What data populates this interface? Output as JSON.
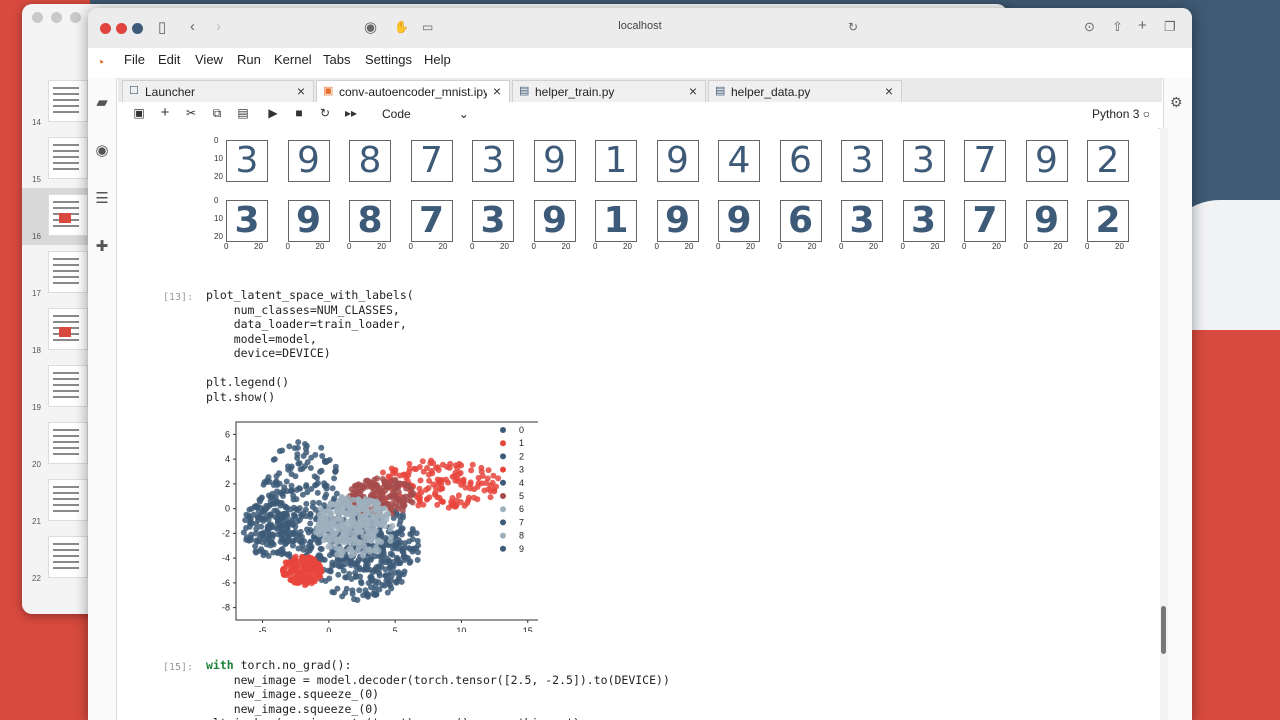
{
  "window": {
    "url": "localhost"
  },
  "menu": [
    "File",
    "Edit",
    "View",
    "Run",
    "Kernel",
    "Tabs",
    "Settings",
    "Help"
  ],
  "tabs": [
    {
      "label": "Launcher",
      "icon": "launcher-icon",
      "active": false
    },
    {
      "label": "conv-autoencoder_mnist.ipy",
      "icon": "notebook-icon",
      "active": true
    },
    {
      "label": "helper_train.py",
      "icon": "python-file-icon",
      "active": false
    },
    {
      "label": "helper_data.py",
      "icon": "python-file-icon",
      "active": false
    }
  ],
  "toolbar": {
    "cell_type": "Code",
    "kernel": "Python 3"
  },
  "slide_numbers": [
    "14",
    "15",
    "16",
    "17",
    "18",
    "19",
    "20",
    "21",
    "22"
  ],
  "digits_original": [
    "3",
    "9",
    "8",
    "7",
    "3",
    "9",
    "1",
    "9",
    "4",
    "6",
    "3",
    "3",
    "7",
    "9",
    "2"
  ],
  "digits_reconstructed": [
    "3",
    "9",
    "8",
    "7",
    "3",
    "9",
    "1",
    "9",
    "9",
    "6",
    "3",
    "3",
    "7",
    "9",
    "2"
  ],
  "digit_axis": {
    "y_ticks": [
      "0",
      "10",
      "20"
    ],
    "x_ticks": [
      "0",
      "20"
    ]
  },
  "cells": [
    {
      "prompt": "[13]:",
      "lines": [
        "plot_latent_space_with_labels(",
        "    num_classes=NUM_CLASSES,",
        "    data_loader=train_loader,",
        "    model=model,",
        "    device=DEVICE)",
        "",
        "plt.legend()",
        "plt.show()"
      ]
    },
    {
      "prompt": "[15]:",
      "lines": [
        "with torch.no_grad():",
        "    new_image = model.decoder(torch.tensor([2.5, -2.5]).to(DEVICE))",
        "    new_image.squeeze_(0)",
        "    new_image.squeeze_(0)",
        "plt.imshow(new_image.to('cpu').numpy(), cmap='binary')"
      ]
    }
  ],
  "chart_data": {
    "type": "scatter",
    "title": "",
    "xlabel": "",
    "ylabel": "",
    "xlim": [
      -7,
      16
    ],
    "ylim": [
      -9,
      7
    ],
    "x_ticks": [
      -5,
      0,
      5,
      10,
      15
    ],
    "y_ticks": [
      6,
      4,
      2,
      0,
      -2,
      -4,
      -6,
      -8
    ],
    "legend": {
      "placement": "right",
      "entries": [
        "0",
        "1",
        "2",
        "3",
        "4",
        "5",
        "6",
        "7",
        "8",
        "9"
      ]
    },
    "series": [
      {
        "name": "0",
        "color": "#3d5a78",
        "cx": 2.5,
        "cy": -4.5,
        "rx": 3.5,
        "ry": 3.0
      },
      {
        "name": "1",
        "color": "#e8453c",
        "cx": 8.0,
        "cy": 2.0,
        "rx": 5.0,
        "ry": 2.0
      },
      {
        "name": "2",
        "color": "#3d5a78",
        "cx": -2.0,
        "cy": 1.0,
        "rx": 3.0,
        "ry": 4.5
      },
      {
        "name": "3",
        "color": "#e8453c",
        "cx": -2.0,
        "cy": -5.0,
        "rx": 1.5,
        "ry": 1.2
      },
      {
        "name": "4",
        "color": "#3d5a78",
        "cx": -4.5,
        "cy": -1.5,
        "rx": 2.0,
        "ry": 2.5
      },
      {
        "name": "5",
        "color": "#a44b4b",
        "cx": 4.0,
        "cy": 1.0,
        "rx": 2.5,
        "ry": 1.5
      },
      {
        "name": "6",
        "color": "#9fb0bd",
        "cx": 2.0,
        "cy": -1.5,
        "rx": 3.0,
        "ry": 2.5
      },
      {
        "name": "7",
        "color": "#3d5a78",
        "cx": 0.0,
        "cy": -2.0,
        "rx": 4.0,
        "ry": 3.0
      },
      {
        "name": "8",
        "color": "#9fb0bd",
        "cx": 1.5,
        "cy": -1.0,
        "rx": 2.5,
        "ry": 2.0
      },
      {
        "name": "9",
        "color": "#3d5a78",
        "cx": 4.0,
        "cy": -3.0,
        "rx": 3.0,
        "ry": 3.0
      }
    ]
  }
}
